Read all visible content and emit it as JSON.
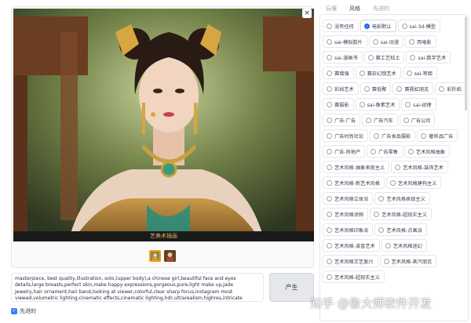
{
  "image": {
    "close_glyph": "×",
    "caption": "艺美术插画",
    "thumbnail_count": 2
  },
  "prompt": {
    "text": "masterpiece, best quality,illustration, solo,(upper body),a chinese girl,beautiful face and eyes details,large breasts,perfect skin,make happy expressions,gorgeous,pure,light make up,jade jewelry,hair ornament,hair band,looking at viewer,colorful,clear sharp focus,instagram most viewed,volumetric lighting,cinematic effects,cinematic lighting,hdr,ultrarealism,highres,intricate details,ultra detailed"
  },
  "generate_button": {
    "label": "产生"
  },
  "advanced": {
    "label": "先进的",
    "checked": true,
    "check_glyph": "✓"
  },
  "tabs": [
    {
      "label": "玩壤",
      "active": false
    },
    {
      "label": "风格",
      "active": true
    },
    {
      "label": "先进的",
      "active": false
    }
  ],
  "styles": [
    {
      "label": "没有任何",
      "selected": false
    },
    {
      "label": "电影默认",
      "selected": true
    },
    {
      "label": "sai-3d-模型",
      "selected": false
    },
    {
      "label": "sai-模拟胶片",
      "selected": false
    },
    {
      "label": "sai-动漫",
      "selected": false
    },
    {
      "label": "西电影",
      "selected": false
    },
    {
      "label": "sai-漫画书",
      "selected": false
    },
    {
      "label": "赛工艺粘土",
      "selected": false
    },
    {
      "label": "sai-数字艺术",
      "selected": false
    },
    {
      "label": "赛增强",
      "selected": false
    },
    {
      "label": "赛奈幻想艺术",
      "selected": false
    },
    {
      "label": "sai-等距",
      "selected": false
    },
    {
      "label": "彩线艺术",
      "selected": false
    },
    {
      "label": "赛低聚",
      "selected": false
    },
    {
      "label": "赛霓虹朋克",
      "selected": false
    },
    {
      "label": "彩折纸",
      "selected": false
    },
    {
      "label": "赛摄影",
      "selected": false
    },
    {
      "label": "sai-像素艺术",
      "selected": false
    },
    {
      "label": "sai-纹理",
      "selected": false
    },
    {
      "label": "广告-广告",
      "selected": false
    },
    {
      "label": "广告汽车",
      "selected": false
    },
    {
      "label": "广告公司",
      "selected": false
    },
    {
      "label": "广告时尚社论",
      "selected": false
    },
    {
      "label": "广告食品摄影",
      "selected": false
    },
    {
      "label": "奢侈品广告",
      "selected": false
    },
    {
      "label": "广告-房地产",
      "selected": false
    },
    {
      "label": "广告零售",
      "selected": false
    },
    {
      "label": "艺术风格抽象",
      "selected": false
    },
    {
      "label": "艺术风格-抽象表现主义",
      "selected": false
    },
    {
      "label": "艺术风格-装饰艺术",
      "selected": false
    },
    {
      "label": "艺术风格-新艺术风格",
      "selected": false
    },
    {
      "label": "艺术风格建构主义",
      "selected": false
    },
    {
      "label": "艺术风格立体派",
      "selected": false
    },
    {
      "label": "艺术风格表现主义",
      "selected": false
    },
    {
      "label": "艺术风格涂鸦",
      "selected": false
    },
    {
      "label": "艺术风格-超现实主义",
      "selected": false
    },
    {
      "label": "艺术风格印象派",
      "selected": false
    },
    {
      "label": "艺术风格-点画派",
      "selected": false
    },
    {
      "label": "艺术风格-波普艺术",
      "selected": false
    },
    {
      "label": "艺术风格迷幻",
      "selected": false
    },
    {
      "label": "艺术风格文艺复兴",
      "selected": false
    },
    {
      "label": "艺术风格-蒸汽朋克",
      "selected": false
    },
    {
      "label": "艺术风格-超现实主义",
      "selected": false
    }
  ],
  "watermark": {
    "text": "知乎 @鲁大师软件开发"
  }
}
